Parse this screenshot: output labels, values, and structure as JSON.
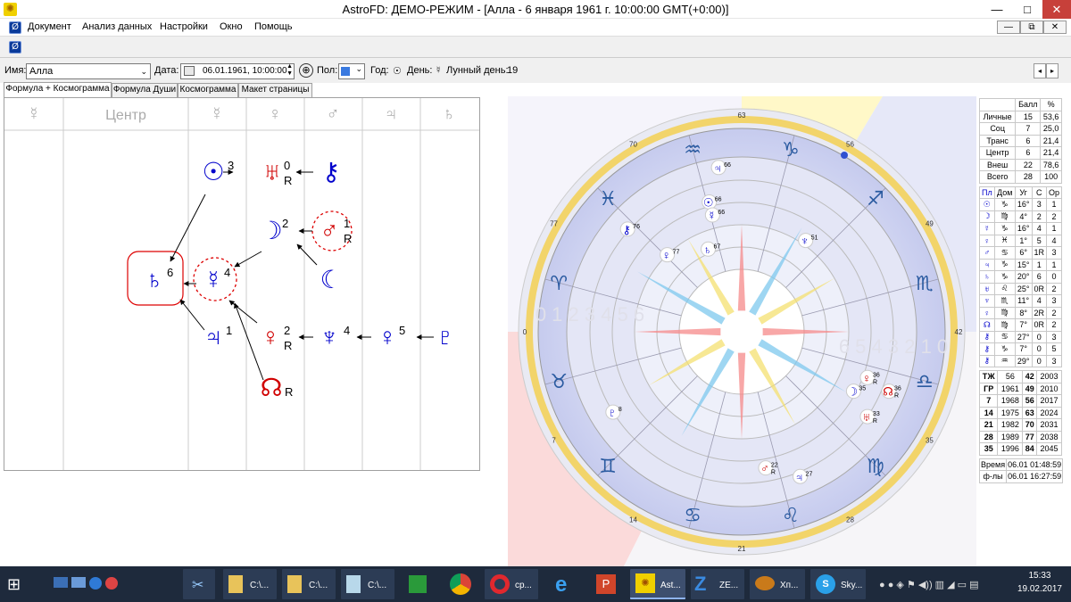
{
  "window": {
    "title": "AstroFD: ДЕМО-РЕЖИМ - [Алла - 6 января 1961 г. 10:00:00 GMT(+0:00)]",
    "minimize": "—",
    "restore": "□",
    "close": "✕"
  },
  "menu": {
    "items": [
      "Документ",
      "Анализ данных",
      "Настройки",
      "Окно",
      "Помощь"
    ]
  },
  "infobar": {
    "name_label": "Имя:",
    "name_value": "Алла",
    "date_label": "Дата:",
    "date_value": "06.01.1961, 10:00:00",
    "sex_label": "Пол:",
    "year_label": "Год:",
    "day_label": "День:",
    "lunar_label": "Лунный день:",
    "lunar_value": "19"
  },
  "tabs": [
    "Формула + Космограмма",
    "Формула Души",
    "Космограмма",
    "Макет страницы"
  ],
  "formula": {
    "header_center": "Центр",
    "header_glyphs": [
      "☿",
      "☿",
      "♀",
      "♂",
      "♃",
      "♄"
    ],
    "nodes": [
      {
        "glyph": "☉",
        "sup": "3",
        "sub": "",
        "color": "#0000cc"
      },
      {
        "glyph": "♅",
        "sup": "0",
        "sub": "R",
        "color": "#d00000"
      },
      {
        "glyph": "⚷",
        "sup": "",
        "sub": "",
        "color": "#0000cc"
      },
      {
        "glyph": "☽",
        "sup": "2",
        "sub": "",
        "color": "#0000cc"
      },
      {
        "glyph": "♂",
        "sup": "1",
        "sub": "R",
        "color": "#d00000"
      },
      {
        "glyph": "♄",
        "sup": "6",
        "sub": "",
        "color": "#0000cc"
      },
      {
        "glyph": "☿",
        "sup": "4",
        "sub": "",
        "color": "#0000cc"
      },
      {
        "glyph": "☾",
        "sup": "",
        "sub": "",
        "color": "#0000cc"
      },
      {
        "glyph": "♃",
        "sup": "1",
        "sub": "",
        "color": "#0000cc"
      },
      {
        "glyph": "♀",
        "sup": "2",
        "sub": "R",
        "color": "#d00000"
      },
      {
        "glyph": "♆",
        "sup": "4",
        "sub": "",
        "color": "#0000cc"
      },
      {
        "glyph": "♀",
        "sup": "5",
        "sub": "",
        "color": "#0000cc"
      },
      {
        "glyph": "♇",
        "sup": "",
        "sub": "",
        "color": "#0000cc"
      },
      {
        "glyph": "☊",
        "sup": "",
        "sub": "R",
        "color": "#d00000"
      }
    ]
  },
  "cosmogram": {
    "degree_labels": [
      "63",
      "56",
      "49",
      "42",
      "35",
      "28",
      "21",
      "14",
      "7",
      "0",
      "77",
      "70"
    ],
    "zodiac": [
      "♑",
      "♐",
      "♏",
      "♎",
      "♍",
      "♌",
      "♋",
      "♊",
      "♉",
      "♈",
      "♓",
      "♒"
    ],
    "planets": [
      {
        "glyph": "♃",
        "num": "66",
        "r": ""
      },
      {
        "glyph": "☉",
        "num": "66",
        "r": ""
      },
      {
        "glyph": "☿",
        "num": "66",
        "r": ""
      },
      {
        "glyph": "⚷",
        "num": "76",
        "r": ""
      },
      {
        "glyph": "♄",
        "num": "67",
        "r": ""
      },
      {
        "glyph": "♆",
        "num": "51",
        "r": ""
      },
      {
        "glyph": "♀",
        "num": "77",
        "r": ""
      },
      {
        "glyph": "♀",
        "num": "36",
        "r": "R"
      },
      {
        "glyph": "☽",
        "num": "35",
        "r": ""
      },
      {
        "glyph": "☊",
        "num": "36",
        "r": "R"
      },
      {
        "glyph": "♅",
        "num": "33",
        "r": "R"
      },
      {
        "glyph": "♇",
        "num": "8",
        "r": ""
      },
      {
        "glyph": "♂",
        "num": "22",
        "r": "R"
      },
      {
        "glyph": "♃",
        "num": "27",
        "r": ""
      }
    ],
    "center_rows": [
      "0 1 2 3 4 5 6",
      "6 5 4 3 2 1 0"
    ]
  },
  "stats": {
    "head": [
      "",
      "Балл",
      "%"
    ],
    "score_rows": [
      [
        "Личные",
        "15",
        "53,6"
      ],
      [
        "Соц",
        "7",
        "25,0"
      ],
      [
        "Транс",
        "6",
        "21,4"
      ],
      [
        "Центр",
        "6",
        "21,4"
      ],
      [
        "Внеш",
        "22",
        "78,6"
      ],
      [
        "Всего",
        "28",
        "100"
      ]
    ],
    "planet_head": [
      "Пл",
      "Дом",
      "Уг",
      "С",
      "Ор"
    ],
    "planet_rows": [
      [
        "☉",
        "♑",
        "16°",
        "3",
        "1"
      ],
      [
        "☽",
        "♍",
        "4°",
        "2",
        "2"
      ],
      [
        "☿",
        "♑",
        "16°",
        "4",
        "1"
      ],
      [
        "♀",
        "♓",
        "1°",
        "5",
        "4"
      ],
      [
        "♂",
        "♋",
        "6°",
        "1R",
        "3"
      ],
      [
        "♃",
        "♑",
        "15°",
        "1",
        "1"
      ],
      [
        "♄",
        "♑",
        "20°",
        "6",
        "0"
      ],
      [
        "♅",
        "♌",
        "25°",
        "0R",
        "2"
      ],
      [
        "♆",
        "♏",
        "11°",
        "4",
        "3"
      ],
      [
        "♀",
        "♍",
        "8°",
        "2R",
        "2"
      ],
      [
        "☊",
        "♍",
        "7°",
        "0R",
        "2"
      ],
      [
        "⚷",
        "♋",
        "27°",
        "0",
        "3"
      ],
      [
        "⚷",
        "♑",
        "7°",
        "0",
        "5"
      ],
      [
        "⚷",
        "♒",
        "29°",
        "0",
        "3"
      ]
    ],
    "year_rows": [
      [
        "ТЖ",
        "56",
        "42",
        "2003"
      ],
      [
        "ГР",
        "1961",
        "49",
        "2010"
      ],
      [
        "7",
        "1968",
        "56",
        "2017"
      ],
      [
        "14",
        "1975",
        "63",
        "2024"
      ],
      [
        "21",
        "1982",
        "70",
        "2031"
      ],
      [
        "28",
        "1989",
        "77",
        "2038"
      ],
      [
        "35",
        "1996",
        "84",
        "2045"
      ]
    ],
    "time_rows": [
      [
        "Время",
        "06.01 01:48:59"
      ],
      [
        "ф-лы",
        "06.01 16:27:59"
      ]
    ]
  },
  "taskbar": {
    "items": [
      "C:\\...",
      "C:\\...",
      "C:\\...",
      "cp...",
      "Ast...",
      "ZE...",
      "Хп...",
      "Sky..."
    ],
    "time": "15:33",
    "date": "19.02.2017"
  }
}
